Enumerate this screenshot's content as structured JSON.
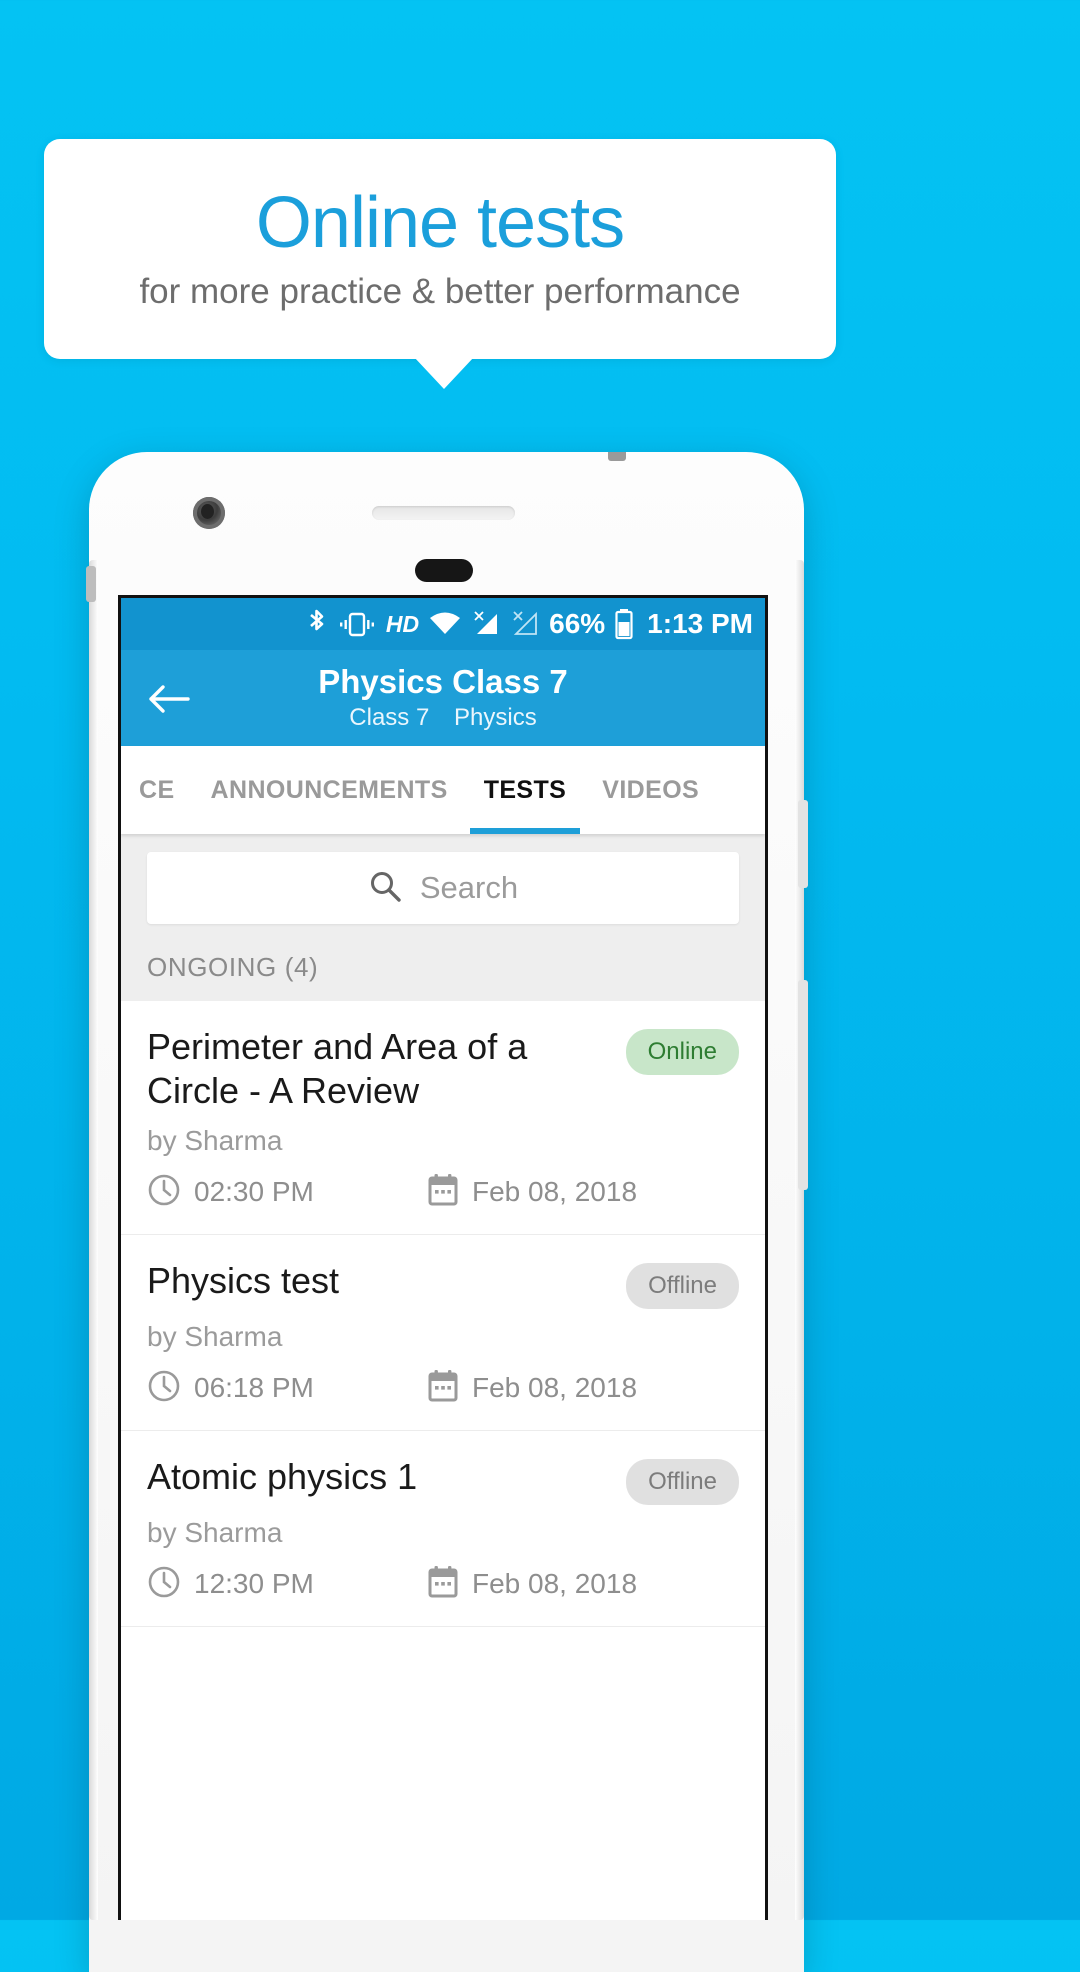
{
  "promo": {
    "title": "Online tests",
    "subtitle": "for more practice & better performance",
    "title_color": "#1b9fdb",
    "subtitle_color": "#6d6d6d",
    "background_color": "#ffffff"
  },
  "background": {
    "gradient_top": "#04c3f3",
    "gradient_bottom": "#00a9e4"
  },
  "phone": {
    "frame_color": "#fdfdfd",
    "icons": {
      "camera": "camera-icon",
      "earpiece": "earpiece-speaker",
      "home": "home-button"
    }
  },
  "statusbar": {
    "background_color": "#1293cf",
    "icons": [
      "bluetooth-icon",
      "vibrate-icon",
      "hd-icon",
      "wifi-icon",
      "signal-no-sim-1-icon",
      "signal-no-sim-2-icon"
    ],
    "hd_label": "HD",
    "battery_percent": "66%",
    "battery_icon": "battery-icon",
    "time": "1:13 PM"
  },
  "appbar": {
    "background_color": "#1e9fd8",
    "back_icon": "back-arrow-icon",
    "title": "Physics Class 7",
    "subtitle_class": "Class 7",
    "subtitle_subject": "Physics"
  },
  "tabs": {
    "active_index": 2,
    "indicator_color": "#1e9fd8",
    "items": [
      {
        "label": "CE"
      },
      {
        "label": "ANNOUNCEMENTS"
      },
      {
        "label": "TESTS"
      },
      {
        "label": "VIDEOS"
      }
    ]
  },
  "search": {
    "icon": "search-icon",
    "placeholder": "Search",
    "value": ""
  },
  "section": {
    "header": "ONGOING (4)"
  },
  "tests": [
    {
      "title": "Perimeter and Area of a Circle - A Review",
      "author": "by Sharma",
      "status": "Online",
      "status_type": "online",
      "time": "02:30 PM",
      "date": "Feb 08, 2018",
      "time_icon": "clock-icon",
      "date_icon": "calendar-icon"
    },
    {
      "title": "Physics test",
      "author": "by Sharma",
      "status": "Offline",
      "status_type": "offline",
      "time": "06:18 PM",
      "date": "Feb 08, 2018",
      "time_icon": "clock-icon",
      "date_icon": "calendar-icon"
    },
    {
      "title": "Atomic physics 1",
      "author": "by Sharma",
      "status": "Offline",
      "status_type": "offline",
      "time": "12:30 PM",
      "date": "Feb 08, 2018",
      "time_icon": "clock-icon",
      "date_icon": "calendar-icon"
    }
  ],
  "colors": {
    "badge_online_bg": "#c8e6c9",
    "badge_online_text": "#2e7d32",
    "badge_offline_bg": "#e0e0e0",
    "badge_offline_text": "#7c7c7c",
    "accent": "#1e9fd8"
  }
}
